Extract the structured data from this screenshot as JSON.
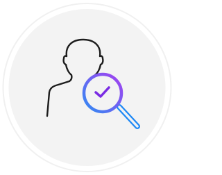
{
  "icon": {
    "name": "user-verification-icon",
    "colors": {
      "outer_ring": "#f0f0f0",
      "badge_background": "#f3f3f3",
      "person_stroke": "#1c1c1c",
      "lens_gradient_start": "#2f8cf3",
      "lens_gradient_end": "#a63ef0",
      "handle_stroke": "#1e88f5",
      "check_stroke": "#7a2be3"
    }
  }
}
